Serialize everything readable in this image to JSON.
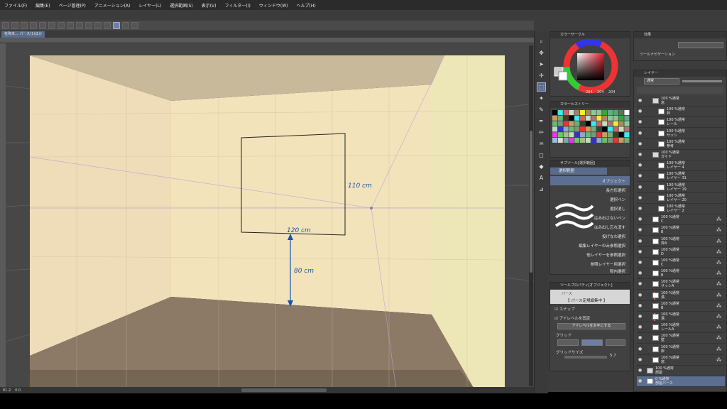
{
  "menu": [
    "ファイル(F)",
    "編集(E)",
    "ページ管理(P)",
    "アニメーション(A)",
    "レイヤー(L)",
    "選択範囲(S)",
    "表示(V)",
    "フィルター(I)",
    "ウィンドウ(W)",
    "ヘルプ(H)"
  ],
  "document_tab": "名称未... パース(1)ほか",
  "canvas": {
    "annotations": {
      "width_110": "110 cm",
      "width_120": "120 cm",
      "height_80": "80 cm"
    },
    "colors": {
      "ceiling": "#c9b99b",
      "left_wall": "#efdcb8",
      "back_wall": "#f2e3bb",
      "right_wall": "#ede7b8",
      "floor_back": "#8c7a66",
      "floor_front": "#6b5c4b",
      "line": "#1a52b0"
    }
  },
  "status": {
    "zoom": "81.2",
    "angle": "0.0"
  },
  "color_circle": {
    "title": "カラーサークル",
    "rgb": [
      "204",
      "204",
      "204"
    ]
  },
  "color_history": {
    "title": "カラーヒストリー"
  },
  "sub_tool": {
    "title": "サブツール[選択範囲]",
    "group": "選択範囲",
    "items": [
      "オブジェクト",
      "長方形選択",
      "選択ペン",
      "選択消し",
      "はみ出さないペン",
      "はみ出し忘れ消す",
      "投げなわ選択",
      "編集レイヤーのみ参照選択",
      "他レイヤーを参照選択",
      "参照レイヤー用選択",
      "隙内選択"
    ]
  },
  "tool_property": {
    "title": "ツールプロパティ[オブジェクト]",
    "subtitle": "パース",
    "editing_label": "【 パース定規編集中 】",
    "snap_label": "スナップ",
    "eye_level_label": "アイレベルを固定",
    "eye_level_button": "アイレベルを水平にする",
    "grid_label": "グリッド",
    "grid_size_label": "グリッドサイズ",
    "grid_size_value": "5.7"
  },
  "effects": {
    "title": "効果"
  },
  "tool_navigation": {
    "title": "ツールナビゲーション"
  },
  "layers_panel": {
    "title": "レイヤー",
    "blend_mode": "通常",
    "rows": [
      {
        "pct": "100 %通常",
        "name": "窓",
        "indent": 1,
        "type": "folder"
      },
      {
        "pct": "100 %通常",
        "name": "枠",
        "indent": 2,
        "type": "raster"
      },
      {
        "pct": "100 %通常",
        "name": "レール",
        "indent": 2,
        "type": "raster"
      },
      {
        "pct": "100 %通常",
        "name": "サッシ",
        "indent": 2,
        "type": "raster"
      },
      {
        "pct": "100 %通常",
        "name": "参考",
        "indent": 2,
        "type": "raster"
      },
      {
        "pct": "100 %通常",
        "name": "ガイド",
        "indent": 1,
        "type": "folder"
      },
      {
        "pct": "100 %通常",
        "name": "レイヤー 4",
        "indent": 2,
        "type": "raster"
      },
      {
        "pct": "100 %通常",
        "name": "レイヤー 31",
        "indent": 2,
        "type": "raster"
      },
      {
        "pct": "100 %通常",
        "name": "レイヤー 19",
        "indent": 2,
        "type": "raster"
      },
      {
        "pct": "100 %通常",
        "name": "レイヤー 20",
        "indent": 2,
        "type": "raster"
      },
      {
        "pct": "100 %通常",
        "name": "レイヤー 2",
        "indent": 2,
        "type": "raster"
      },
      {
        "pct": "100 %通常",
        "name": "C",
        "indent": 1,
        "type": "raster"
      },
      {
        "pct": "100 %通常",
        "name": "B",
        "indent": 1,
        "type": "raster"
      },
      {
        "pct": "100 %通常",
        "name": "枠A",
        "indent": 1,
        "type": "raster"
      },
      {
        "pct": "100 %通常",
        "name": "D",
        "indent": 1,
        "type": "raster"
      },
      {
        "pct": "100 %通常",
        "name": "C",
        "indent": 1,
        "type": "raster"
      },
      {
        "pct": "100 %通常",
        "name": "B",
        "indent": 1,
        "type": "raster"
      },
      {
        "pct": "100 %通常",
        "name": "サッシA",
        "indent": 1,
        "type": "raster"
      },
      {
        "pct": "100 %通常",
        "name": "溝",
        "indent": 1,
        "type": "raster",
        "mark": true
      },
      {
        "pct": "100 %通常",
        "name": "B",
        "indent": 1,
        "type": "raster"
      },
      {
        "pct": "100 %通常",
        "name": "溝",
        "indent": 1,
        "type": "raster",
        "mark": true
      },
      {
        "pct": "100 %通常",
        "name": "レールA",
        "indent": 1,
        "type": "raster"
      },
      {
        "pct": "100 %通常",
        "name": "壁",
        "indent": 1,
        "type": "raster"
      },
      {
        "pct": "100 %通常",
        "name": "床",
        "indent": 1,
        "type": "raster"
      },
      {
        "pct": "100 %通常",
        "name": "窓",
        "indent": 1,
        "type": "raster"
      },
      {
        "pct": "100 %通常",
        "name": "部屋",
        "indent": 0,
        "type": "folder"
      },
      {
        "pct": "0 %通常",
        "name": "部屋パース",
        "indent": 0,
        "type": "perspective",
        "active": true
      }
    ]
  }
}
